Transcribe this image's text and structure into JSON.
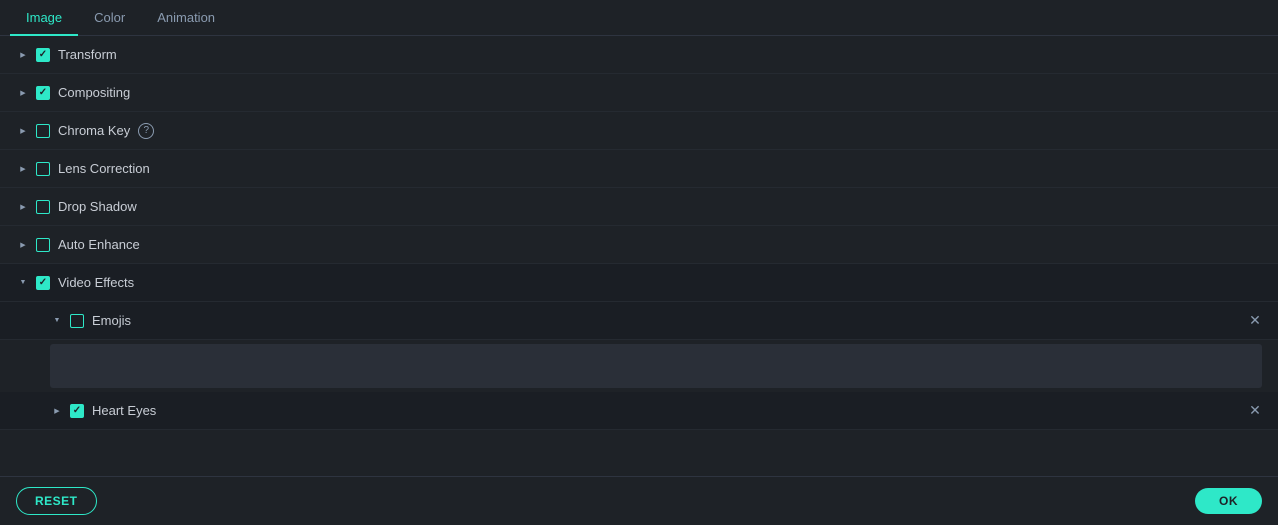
{
  "tabs": [
    {
      "label": "Image",
      "active": true
    },
    {
      "label": "Color",
      "active": false
    },
    {
      "label": "Animation",
      "active": false
    }
  ],
  "sections": [
    {
      "id": "transform",
      "label": "Transform",
      "checked": true,
      "expanded": false,
      "help": false,
      "indent": 0
    },
    {
      "id": "compositing",
      "label": "Compositing",
      "checked": true,
      "expanded": false,
      "help": false,
      "indent": 0
    },
    {
      "id": "chroma-key",
      "label": "Chroma Key",
      "checked": false,
      "expanded": false,
      "help": true,
      "indent": 0
    },
    {
      "id": "lens-correction",
      "label": "Lens Correction",
      "checked": false,
      "expanded": false,
      "help": false,
      "indent": 0
    },
    {
      "id": "drop-shadow",
      "label": "Drop Shadow",
      "checked": false,
      "expanded": false,
      "help": false,
      "indent": 0
    },
    {
      "id": "auto-enhance",
      "label": "Auto Enhance",
      "checked": false,
      "expanded": false,
      "help": false,
      "indent": 0
    },
    {
      "id": "video-effects",
      "label": "Video Effects",
      "checked": true,
      "expanded": true,
      "help": false,
      "indent": 0
    }
  ],
  "video_effects_sub": [
    {
      "id": "emojis",
      "label": "Emojis",
      "checked": false,
      "expanded": true,
      "hasContent": true
    },
    {
      "id": "heart-eyes",
      "label": "Heart Eyes",
      "checked": true,
      "expanded": false,
      "hasContent": false
    }
  ],
  "footer": {
    "reset_label": "RESET",
    "ok_label": "OK"
  },
  "icons": {
    "close": "✕",
    "help": "?"
  }
}
